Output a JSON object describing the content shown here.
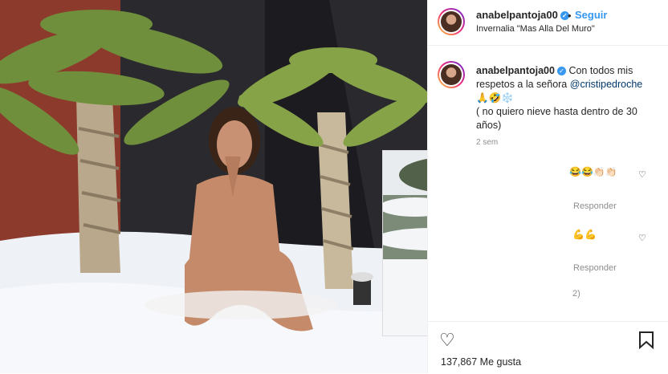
{
  "post": {
    "username": "anabelpantoja00",
    "follow_label": "Seguir",
    "location": "Invernalia \"Mas Alla Del Muro\"",
    "more_icon": "more-options-icon",
    "caption_user": "anabelpantoja00",
    "caption_text": "Con todos mis respetos a la señora",
    "caption_mention": "@cristipedroche",
    "caption_emojis": "🙏🤣❄️",
    "caption_line2": "( no quiero nieve hasta dentro de 30 años)",
    "time_ago": "2 sem",
    "comments": [
      {
        "fragment": "😂😂👏🏻👏🏻",
        "reply_label": "Responder"
      },
      {
        "fragment": "💪💪",
        "reply_label": "Responder"
      }
    ],
    "view_replies_fragment": "2)",
    "likes": "137,867 Me gusta"
  },
  "colors": {
    "accent_blue": "#3897f0",
    "text": "#262626",
    "muted": "#8e8e8e",
    "wall_red": "#8c3a2b"
  }
}
